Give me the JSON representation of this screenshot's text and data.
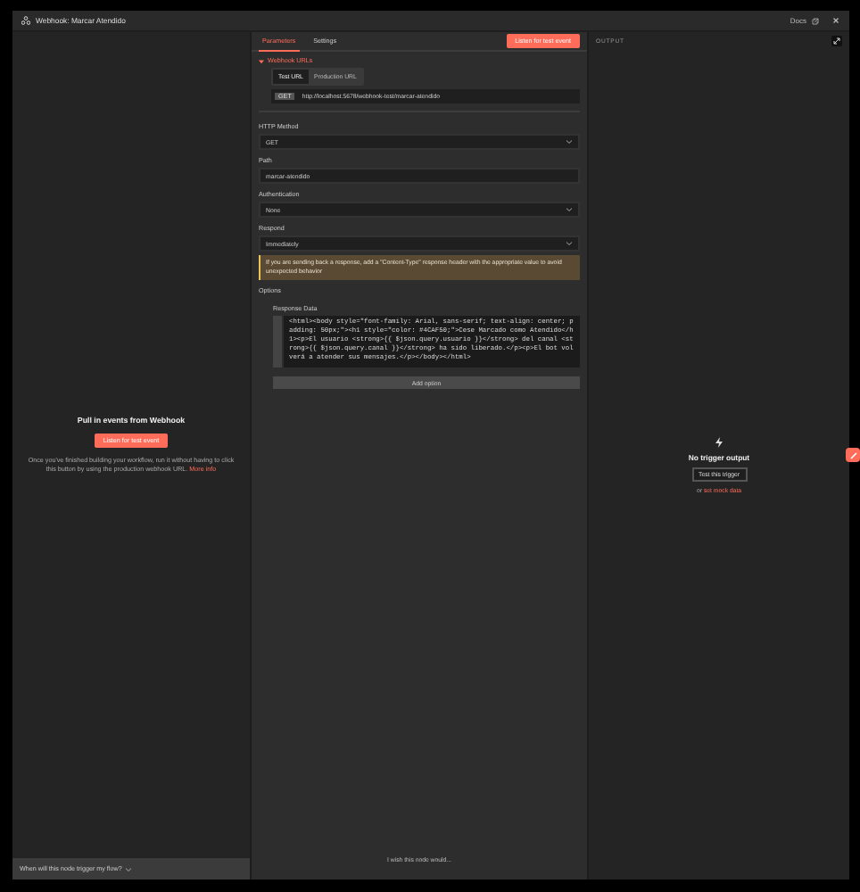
{
  "window": {
    "title": "Webhook: Marcar Atendido",
    "docs_label": "Docs"
  },
  "left_panel": {
    "heading": "Pull in events from Webhook",
    "button": "Listen for test event",
    "description": "Once you've finished building your workflow, run it without having to click this button by using the production webhook URL.",
    "link": "More info",
    "footer": "When will this node trigger my flow?"
  },
  "tabs": [
    {
      "label": "Parameters",
      "selected": true
    },
    {
      "label": "Settings",
      "selected": false
    }
  ],
  "listen_button": "Listen for test event",
  "webhook_urls": {
    "label": "Webhook URLs",
    "expanded": true,
    "toggles": [
      {
        "label": "Test URL",
        "selected": true
      },
      {
        "label": "Production URL",
        "selected": false
      }
    ],
    "method_badge": "GET",
    "url": "http://localhost:5678/webhook-test/marcar-atendido"
  },
  "fields": [
    {
      "label": "HTTP Method",
      "value": "GET",
      "kind": "select"
    },
    {
      "label": "Path",
      "value": "marcar-atendido",
      "kind": "text"
    },
    {
      "label": "Authentication",
      "value": "None",
      "kind": "select"
    },
    {
      "label": "Respond",
      "value": "Immediately",
      "kind": "select"
    }
  ],
  "notice": "If you are sending back a response, add a \"Content-Type\" response header with the appropriate value to avoid unexpected behavior",
  "options": {
    "label": "Options",
    "response_data": {
      "label": "Response Data",
      "code": "<html><body style=\"font-family: Arial, sans-serif; text-align: center; padding: 50px;\"><h1 style=\"color: #4CAF50;\">Cese Marcado como Atendido</h1><p>El usuario <strong>{{ $json.query.usuario }}</strong> del canal <strong>{{ $json.query.canal }}</strong> ha sido liberado.</p><p>El bot volverá a atender sus mensajes.</p></body></html>"
    },
    "add_button": "Add option"
  },
  "feedback": "I wish this node would...",
  "output": {
    "label": "OUTPUT",
    "heading": "No trigger output",
    "button": "Test this trigger",
    "or": "or",
    "link": "set mock data"
  }
}
